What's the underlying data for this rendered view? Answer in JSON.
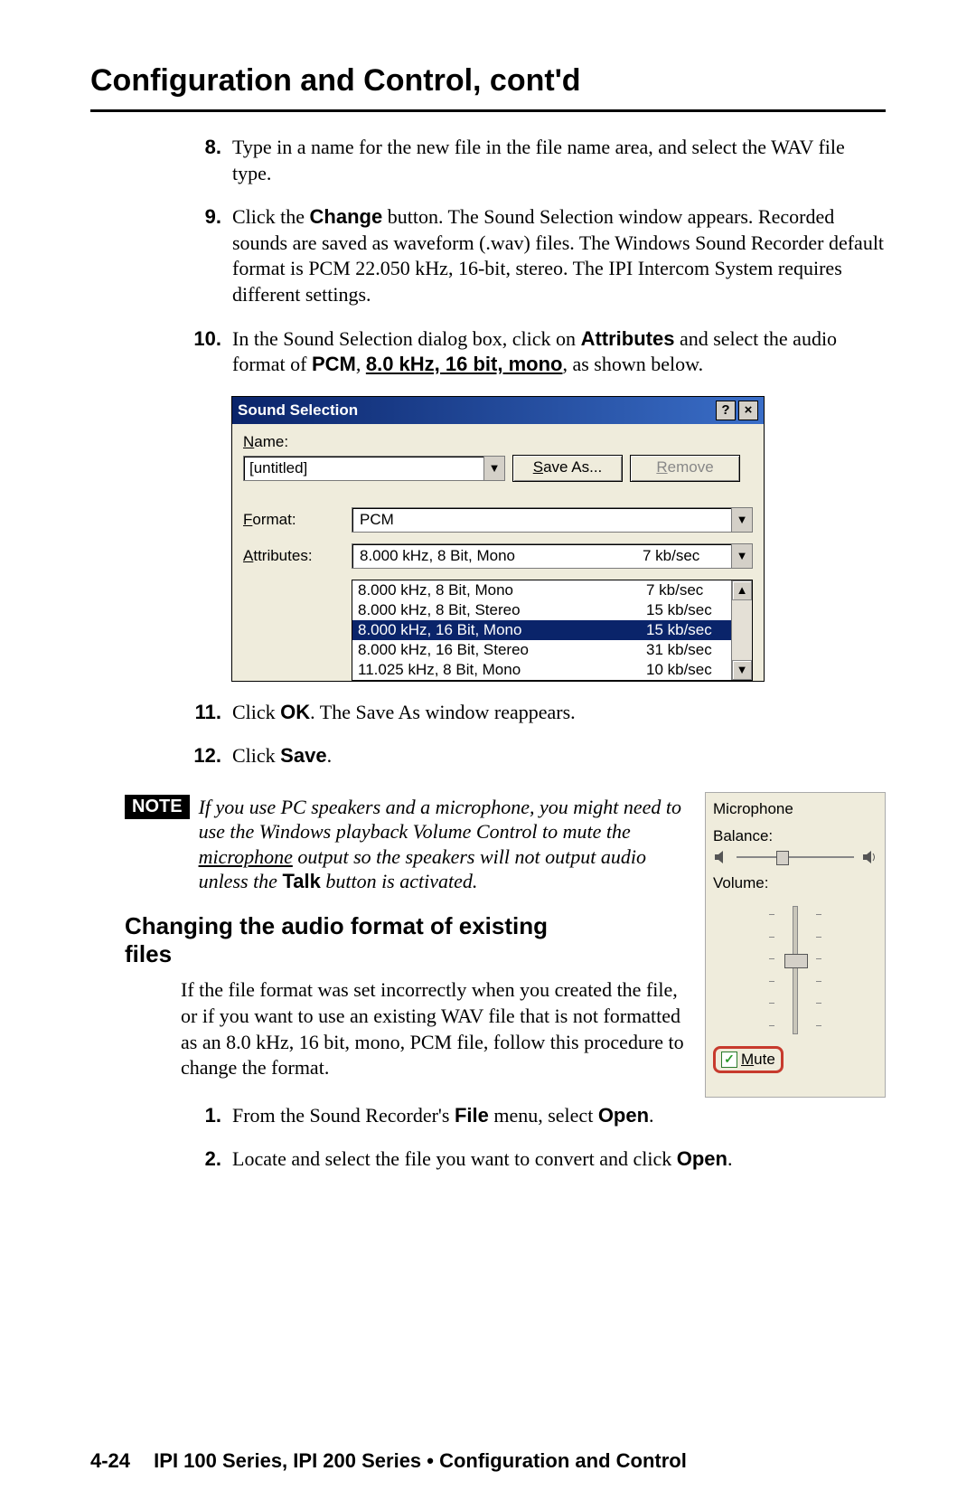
{
  "title": "Configuration and Control, cont'd",
  "steps_a": [
    {
      "num": "8.",
      "text": "Type in a name for the new file in the file name area, and select the WAV file type."
    },
    {
      "num": "9.",
      "html": "Click the <b class='sans'>Change</b> button.  The Sound Selection window appears.  Recorded sounds are saved as waveform (.wav) files.  The Windows Sound Recorder default format is PCM 22.050 kHz, 16-bit, stereo.  The IPI Intercom System requires different settings."
    },
    {
      "num": "10.",
      "html": "In the Sound Selection dialog box, click on <b class='sans'>Attributes</b> and select the audio format of <b class='sans'>PCM</b>, <b class='sans'><u>8.0 kHz, 16 bit, mono</u></b>, as shown below."
    }
  ],
  "dialog": {
    "title": "Sound Selection",
    "help_btn": "?",
    "close_btn": "×",
    "name_label": "Name:",
    "name_value": "[untitled]",
    "save_as": "Save As...",
    "remove": "Remove",
    "format_label": "Format:",
    "format_value": "PCM",
    "attr_label": "Attributes:",
    "attr_selected_fmt": "8.000 kHz, 8 Bit, Mono",
    "attr_selected_rate": "7 kb/sec",
    "options": [
      {
        "fmt": "8.000 kHz, 8 Bit, Mono",
        "rate": "7 kb/sec",
        "sel": false
      },
      {
        "fmt": "8.000 kHz, 8 Bit, Stereo",
        "rate": "15 kb/sec",
        "sel": false
      },
      {
        "fmt": "8.000 kHz, 16 Bit, Mono",
        "rate": "15 kb/sec",
        "sel": true
      },
      {
        "fmt": "8.000 kHz, 16 Bit, Stereo",
        "rate": "31 kb/sec",
        "sel": false
      },
      {
        "fmt": "11.025 kHz, 8 Bit, Mono",
        "rate": "10 kb/sec",
        "sel": false
      }
    ],
    "scroll_up": "▲",
    "scroll_down": "▼",
    "dd_arrow": "▼"
  },
  "steps_b": [
    {
      "num": "11.",
      "html": "Click <b class='sans'>OK</b>.  The Save As window reappears."
    },
    {
      "num": "12.",
      "html": "Click <b class='sans'>Save</b>."
    }
  ],
  "note_badge": "NOTE",
  "note_html": "If you use PC speakers and a microphone, you might need to use the Windows playback Volume Control to mute the <u>microphone</u> output so the speakers will not output audio unless the <b class='sans nb'>Talk</b> button is activated.",
  "subhead": "Changing the audio format of existing files",
  "para": "If the file format was set incorrectly when you created the file, or if you want to use an existing WAV file that is not formatted as an 8.0 kHz, 16 bit, mono, PCM file, follow this procedure to change the format.",
  "steps_c": [
    {
      "num": "1.",
      "html": "From the Sound Recorder's <b class='sans'>File</b> menu, select <b class='sans'>Open</b>."
    },
    {
      "num": "2.",
      "html": "Locate and select the file you want to convert and click <b class='sans'>Open</b>."
    }
  ],
  "vol": {
    "title": "Microphone",
    "balance": "Balance:",
    "volume": "Volume:",
    "mute": "Mute",
    "check": "✓"
  },
  "footer": {
    "pn": "4-24",
    "text": "IPI 100 Series, IPI 200 Series • Configuration and Control"
  }
}
